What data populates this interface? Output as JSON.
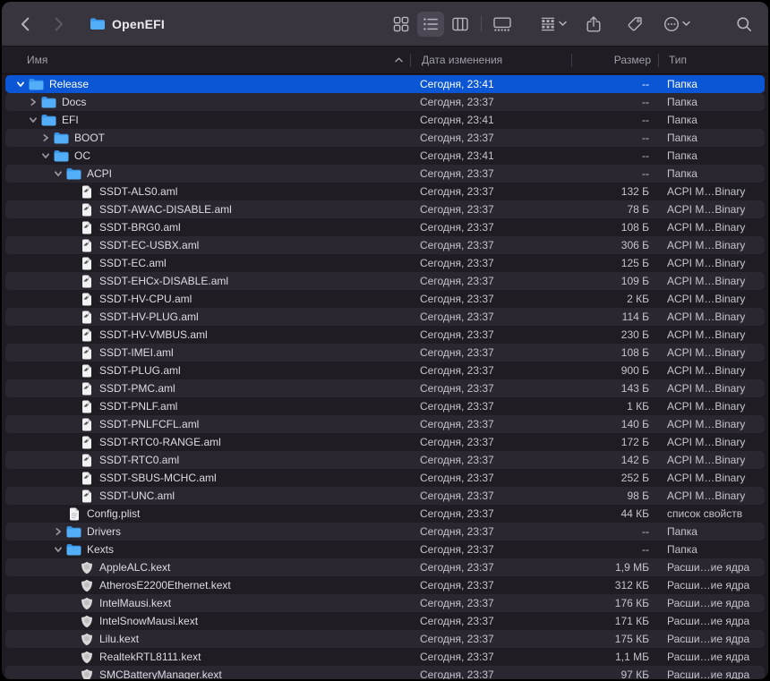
{
  "window": {
    "title": "OpenEFI"
  },
  "toolbar": {
    "icons": [
      "back",
      "forward",
      "folder-proxy",
      "grid-view",
      "list-view",
      "column-view",
      "gallery-view",
      "group-by",
      "share",
      "tag",
      "more",
      "search"
    ],
    "selected_view": "list-view"
  },
  "header": {
    "columns": {
      "name": "Имя",
      "date": "Дата изменения",
      "size": "Размер",
      "type": "Тип"
    },
    "sort": "name-ascending"
  },
  "colors": {
    "selection": "#0a56d5",
    "toolbar_bg": "#39353f",
    "row_bg": "#1f1d23",
    "row_alt_bg": "#2a2731",
    "folder_blue": "#52aef7",
    "frame": "#000000"
  },
  "rows": [
    {
      "name": "Release",
      "level": 0,
      "icon": "folder",
      "disclosure": "expanded",
      "selected": true,
      "date": "Сегодня, 23:41",
      "size": "--",
      "type": "Папка"
    },
    {
      "name": "Docs",
      "level": 1,
      "icon": "folder",
      "disclosure": "collapsed",
      "selected": false,
      "date": "Сегодня, 23:37",
      "size": "--",
      "type": "Папка"
    },
    {
      "name": "EFI",
      "level": 1,
      "icon": "folder",
      "disclosure": "expanded",
      "selected": false,
      "date": "Сегодня, 23:41",
      "size": "--",
      "type": "Папка"
    },
    {
      "name": "BOOT",
      "level": 2,
      "icon": "folder",
      "disclosure": "collapsed",
      "selected": false,
      "date": "Сегодня, 23:37",
      "size": "--",
      "type": "Папка"
    },
    {
      "name": "OC",
      "level": 2,
      "icon": "folder",
      "disclosure": "expanded",
      "selected": false,
      "date": "Сегодня, 23:41",
      "size": "--",
      "type": "Папка"
    },
    {
      "name": "ACPI",
      "level": 3,
      "icon": "folder",
      "disclosure": "expanded",
      "selected": false,
      "date": "Сегодня, 23:37",
      "size": "--",
      "type": "Папка"
    },
    {
      "name": "SSDT-ALS0.aml",
      "level": 4,
      "icon": "aml",
      "disclosure": null,
      "selected": false,
      "date": "Сегодня, 23:37",
      "size": "132 Б",
      "type": "ACPI M…Binary"
    },
    {
      "name": "SSDT-AWAC-DISABLE.aml",
      "level": 4,
      "icon": "aml",
      "disclosure": null,
      "selected": false,
      "date": "Сегодня, 23:37",
      "size": "78 Б",
      "type": "ACPI M…Binary"
    },
    {
      "name": "SSDT-BRG0.aml",
      "level": 4,
      "icon": "aml",
      "disclosure": null,
      "selected": false,
      "date": "Сегодня, 23:37",
      "size": "108 Б",
      "type": "ACPI M…Binary"
    },
    {
      "name": "SSDT-EC-USBX.aml",
      "level": 4,
      "icon": "aml",
      "disclosure": null,
      "selected": false,
      "date": "Сегодня, 23:37",
      "size": "306 Б",
      "type": "ACPI M…Binary"
    },
    {
      "name": "SSDT-EC.aml",
      "level": 4,
      "icon": "aml",
      "disclosure": null,
      "selected": false,
      "date": "Сегодня, 23:37",
      "size": "125 Б",
      "type": "ACPI M…Binary"
    },
    {
      "name": "SSDT-EHCx-DISABLE.aml",
      "level": 4,
      "icon": "aml",
      "disclosure": null,
      "selected": false,
      "date": "Сегодня, 23:37",
      "size": "109 Б",
      "type": "ACPI M…Binary"
    },
    {
      "name": "SSDT-HV-CPU.aml",
      "level": 4,
      "icon": "aml",
      "disclosure": null,
      "selected": false,
      "date": "Сегодня, 23:37",
      "size": "2 КБ",
      "type": "ACPI M…Binary"
    },
    {
      "name": "SSDT-HV-PLUG.aml",
      "level": 4,
      "icon": "aml",
      "disclosure": null,
      "selected": false,
      "date": "Сегодня, 23:37",
      "size": "114 Б",
      "type": "ACPI M…Binary"
    },
    {
      "name": "SSDT-HV-VMBUS.aml",
      "level": 4,
      "icon": "aml",
      "disclosure": null,
      "selected": false,
      "date": "Сегодня, 23:37",
      "size": "230 Б",
      "type": "ACPI M…Binary"
    },
    {
      "name": "SSDT-IMEI.aml",
      "level": 4,
      "icon": "aml",
      "disclosure": null,
      "selected": false,
      "date": "Сегодня, 23:37",
      "size": "108 Б",
      "type": "ACPI M…Binary"
    },
    {
      "name": "SSDT-PLUG.aml",
      "level": 4,
      "icon": "aml",
      "disclosure": null,
      "selected": false,
      "date": "Сегодня, 23:37",
      "size": "900 Б",
      "type": "ACPI M…Binary"
    },
    {
      "name": "SSDT-PMC.aml",
      "level": 4,
      "icon": "aml",
      "disclosure": null,
      "selected": false,
      "date": "Сегодня, 23:37",
      "size": "143 Б",
      "type": "ACPI M…Binary"
    },
    {
      "name": "SSDT-PNLF.aml",
      "level": 4,
      "icon": "aml",
      "disclosure": null,
      "selected": false,
      "date": "Сегодня, 23:37",
      "size": "1 КБ",
      "type": "ACPI M…Binary"
    },
    {
      "name": "SSDT-PNLFCFL.aml",
      "level": 4,
      "icon": "aml",
      "disclosure": null,
      "selected": false,
      "date": "Сегодня, 23:37",
      "size": "140 Б",
      "type": "ACPI M…Binary"
    },
    {
      "name": "SSDT-RTC0-RANGE.aml",
      "level": 4,
      "icon": "aml",
      "disclosure": null,
      "selected": false,
      "date": "Сегодня, 23:37",
      "size": "172 Б",
      "type": "ACPI M…Binary"
    },
    {
      "name": "SSDT-RTC0.aml",
      "level": 4,
      "icon": "aml",
      "disclosure": null,
      "selected": false,
      "date": "Сегодня, 23:37",
      "size": "142 Б",
      "type": "ACPI M…Binary"
    },
    {
      "name": "SSDT-SBUS-MCHC.aml",
      "level": 4,
      "icon": "aml",
      "disclosure": null,
      "selected": false,
      "date": "Сегодня, 23:37",
      "size": "252 Б",
      "type": "ACPI M…Binary"
    },
    {
      "name": "SSDT-UNC.aml",
      "level": 4,
      "icon": "aml",
      "disclosure": null,
      "selected": false,
      "date": "Сегодня, 23:37",
      "size": "98 Б",
      "type": "ACPI M…Binary"
    },
    {
      "name": "Config.plist",
      "level": 3,
      "icon": "plist",
      "disclosure": null,
      "selected": false,
      "date": "Сегодня, 23:37",
      "size": "44 КБ",
      "type": "список свойств"
    },
    {
      "name": "Drivers",
      "level": 3,
      "icon": "folder",
      "disclosure": "collapsed",
      "selected": false,
      "date": "Сегодня, 23:37",
      "size": "--",
      "type": "Папка"
    },
    {
      "name": "Kexts",
      "level": 3,
      "icon": "folder",
      "disclosure": "expanded",
      "selected": false,
      "date": "Сегодня, 23:37",
      "size": "--",
      "type": "Папка"
    },
    {
      "name": "AppleALC.kext",
      "level": 4,
      "icon": "kext",
      "disclosure": null,
      "selected": false,
      "date": "Сегодня, 23:37",
      "size": "1,9 МБ",
      "type": "Расши…ие ядра"
    },
    {
      "name": "AtherosE2200Ethernet.kext",
      "level": 4,
      "icon": "kext",
      "disclosure": null,
      "selected": false,
      "date": "Сегодня, 23:37",
      "size": "312 КБ",
      "type": "Расши…ие ядра"
    },
    {
      "name": "IntelMausi.kext",
      "level": 4,
      "icon": "kext",
      "disclosure": null,
      "selected": false,
      "date": "Сегодня, 23:37",
      "size": "176 КБ",
      "type": "Расши…ие ядра"
    },
    {
      "name": "IntelSnowMausi.kext",
      "level": 4,
      "icon": "kext",
      "disclosure": null,
      "selected": false,
      "date": "Сегодня, 23:37",
      "size": "171 КБ",
      "type": "Расши…ие ядра"
    },
    {
      "name": "Lilu.kext",
      "level": 4,
      "icon": "kext",
      "disclosure": null,
      "selected": false,
      "date": "Сегодня, 23:37",
      "size": "175 КБ",
      "type": "Расши…ие ядра"
    },
    {
      "name": "RealtekRTL8111.kext",
      "level": 4,
      "icon": "kext",
      "disclosure": null,
      "selected": false,
      "date": "Сегодня, 23:37",
      "size": "1,1 МБ",
      "type": "Расши…ие ядра"
    },
    {
      "name": "SMCBatteryManager.kext",
      "level": 4,
      "icon": "kext",
      "disclosure": null,
      "selected": false,
      "date": "Сегодня, 23:37",
      "size": "97 КБ",
      "type": "Расши…ие ядра"
    }
  ]
}
